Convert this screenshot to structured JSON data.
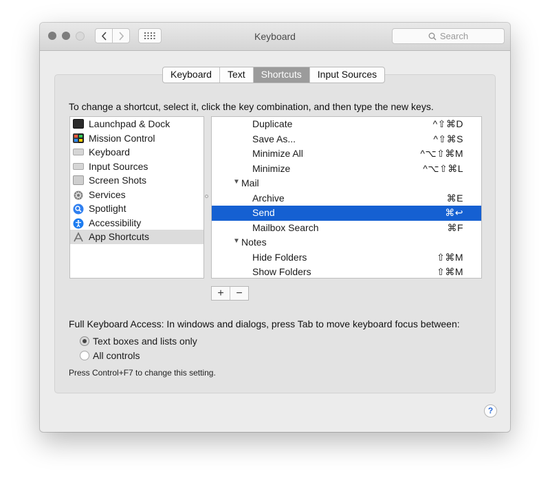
{
  "window": {
    "title": "Keyboard"
  },
  "search": {
    "placeholder": "Search"
  },
  "tabs": [
    {
      "label": "Keyboard"
    },
    {
      "label": "Text"
    },
    {
      "label": "Shortcuts",
      "selected": true
    },
    {
      "label": "Input Sources"
    }
  ],
  "instruction": "To change a shortcut, select it, click the key combination, and then type the new keys.",
  "categories": [
    {
      "label": "Launchpad & Dock",
      "icon": "launchpad-dock-icon"
    },
    {
      "label": "Mission Control",
      "icon": "mission-control-icon"
    },
    {
      "label": "Keyboard",
      "icon": "keyboard-icon"
    },
    {
      "label": "Input Sources",
      "icon": "input-sources-icon"
    },
    {
      "label": "Screen Shots",
      "icon": "screenshot-icon"
    },
    {
      "label": "Services",
      "icon": "gear-icon"
    },
    {
      "label": "Spotlight",
      "icon": "spotlight-icon"
    },
    {
      "label": "Accessibility",
      "icon": "accessibility-icon"
    },
    {
      "label": "App Shortcuts",
      "icon": "app-shortcuts-icon",
      "selected": true
    }
  ],
  "shortcuts": [
    {
      "type": "item",
      "label": "Duplicate",
      "keys": "^⇧⌘D"
    },
    {
      "type": "item",
      "label": "Save As...",
      "keys": "^⇧⌘S"
    },
    {
      "type": "item",
      "label": "Minimize All",
      "keys": "^⌥⇧⌘M"
    },
    {
      "type": "item",
      "label": "Minimize",
      "keys": "^⌥⇧⌘L"
    },
    {
      "type": "group",
      "label": "Mail"
    },
    {
      "type": "item",
      "label": "Archive",
      "keys": "⌘E"
    },
    {
      "type": "item",
      "label": "Send",
      "keys": "⌘↩",
      "selected": true
    },
    {
      "type": "item",
      "label": "Mailbox Search",
      "keys": "⌘F"
    },
    {
      "type": "group",
      "label": "Notes"
    },
    {
      "type": "item",
      "label": "Hide Folders",
      "keys": "⇧⌘M"
    },
    {
      "type": "item",
      "label": "Show Folders",
      "keys": "⇧⌘M"
    }
  ],
  "buttons": {
    "add": "+",
    "remove": "−"
  },
  "full_keyboard_access": {
    "label": "Full Keyboard Access: In windows and dialogs, press Tab to move keyboard focus between:",
    "options": [
      {
        "label": "Text boxes and lists only",
        "checked": true
      },
      {
        "label": "All controls",
        "checked": false
      }
    ],
    "note": "Press Control+F7 to change this setting."
  },
  "help": {
    "label": "?"
  },
  "colors": {
    "selection": "#1560d2",
    "accent_link": "#2a6ad7"
  }
}
